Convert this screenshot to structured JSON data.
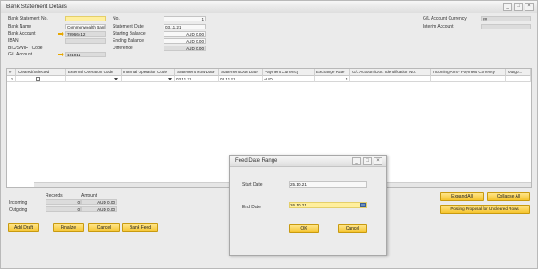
{
  "window": {
    "title": "Bank Statement Details",
    "controls": [
      "_",
      "□",
      "×"
    ]
  },
  "left_fields": [
    {
      "label": "Bank Statement No.",
      "value": ""
    },
    {
      "label": "Bank Name",
      "value": "Commonwealth Bank"
    },
    {
      "label": "Bank Account",
      "value": "78966412"
    },
    {
      "label": "IBAN",
      "value": ""
    },
    {
      "label": "BIC/SWIFT Code",
      "value": ""
    },
    {
      "label": "G/L Account",
      "value": "161012"
    }
  ],
  "middle_fields": [
    {
      "label": "No.",
      "value": "1"
    },
    {
      "label": "Statement Date",
      "value": "03.11.21"
    },
    {
      "label": "Starting Balance",
      "value": "AUD 0.00"
    },
    {
      "label": "Ending Balance",
      "value": "AUD 0.00"
    },
    {
      "label": "Difference",
      "value": "AUD 0.00"
    }
  ],
  "right_fields": [
    {
      "label": "G/L Account Currency",
      "value": "##"
    },
    {
      "label": "Interim Account",
      "value": ""
    }
  ],
  "grid": {
    "headers": [
      "#",
      "Cleared/Selected",
      "External Operation Code",
      "Internal Operation Code",
      "Statement Row Date",
      "Statement Due Date",
      "Payment Currency",
      "Exchange Rate",
      "G/L Account/Doc. Identification No.",
      "Incoming Amt - Payment Currency",
      "Outgo..."
    ],
    "rows": [
      {
        "num": "1",
        "ext_code": "",
        "int_code": "",
        "row_date": "03.11.21",
        "due_date": "03.11.21",
        "currency": "AUD",
        "rate": "1",
        "gl": "",
        "incoming": "",
        "outgoing": ""
      }
    ]
  },
  "totals": {
    "col_records": "Records",
    "col_amount": "Amount",
    "rows": [
      {
        "label": "Incoming",
        "records": "0",
        "amount": "AUD 0.00"
      },
      {
        "label": "Outgoing",
        "records": "0",
        "amount": "AUD 0.00"
      }
    ]
  },
  "buttons": {
    "add_draft": "Add Draft",
    "finalize": "Finalize",
    "cancel": "Cancel",
    "bank_feed": "Bank Feed",
    "expand_all": "Expand All",
    "collapse_all": "Collapse All",
    "posting_proposal": "Posting Proposal for Uncleared Rows"
  },
  "dialog": {
    "title": "Feed Date Range",
    "controls": [
      "_",
      "□",
      "×"
    ],
    "start_label": "Start Date",
    "start_value": "25.10.21",
    "end_label": "End Date",
    "end_value": "26.10.21",
    "ok": "OK",
    "cancel": "Cancel"
  },
  "colors": {
    "accent": "#f5c42c",
    "mandatory_field": "#ffef9e",
    "link_arrow": "#e7a700"
  }
}
